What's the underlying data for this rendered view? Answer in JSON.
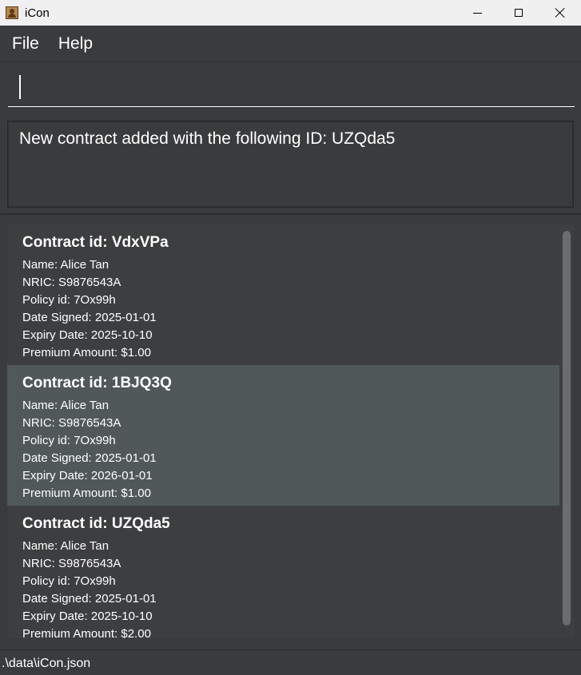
{
  "window": {
    "title": "iCon"
  },
  "menu": {
    "items": [
      "File",
      "Help"
    ]
  },
  "command": {
    "value": ""
  },
  "result": {
    "message": "New contract added with the following ID: UZQda5"
  },
  "contracts": [
    {
      "title": "Contract id: VdxVPa",
      "name": "Name: Alice Tan",
      "nric": "NRIC: S9876543A",
      "policy": "Policy id: 7Ox99h",
      "signed": "Date Signed: 2025-01-01",
      "expiry": "Expiry Date: 2025-10-10",
      "premium": "Premium Amount: $1.00",
      "selected": false
    },
    {
      "title": "Contract id: 1BJQ3Q",
      "name": "Name: Alice Tan",
      "nric": "NRIC: S9876543A",
      "policy": "Policy id: 7Ox99h",
      "signed": "Date Signed: 2025-01-01",
      "expiry": "Expiry Date: 2026-01-01",
      "premium": "Premium Amount: $1.00",
      "selected": true
    },
    {
      "title": "Contract id: UZQda5",
      "name": "Name: Alice Tan",
      "nric": "NRIC: S9876543A",
      "policy": "Policy id: 7Ox99h",
      "signed": "Date Signed: 2025-01-01",
      "expiry": "Expiry Date: 2025-10-10",
      "premium": "Premium Amount: $2.00",
      "selected": false
    }
  ],
  "status": {
    "path": ".\\data\\iCon.json"
  }
}
